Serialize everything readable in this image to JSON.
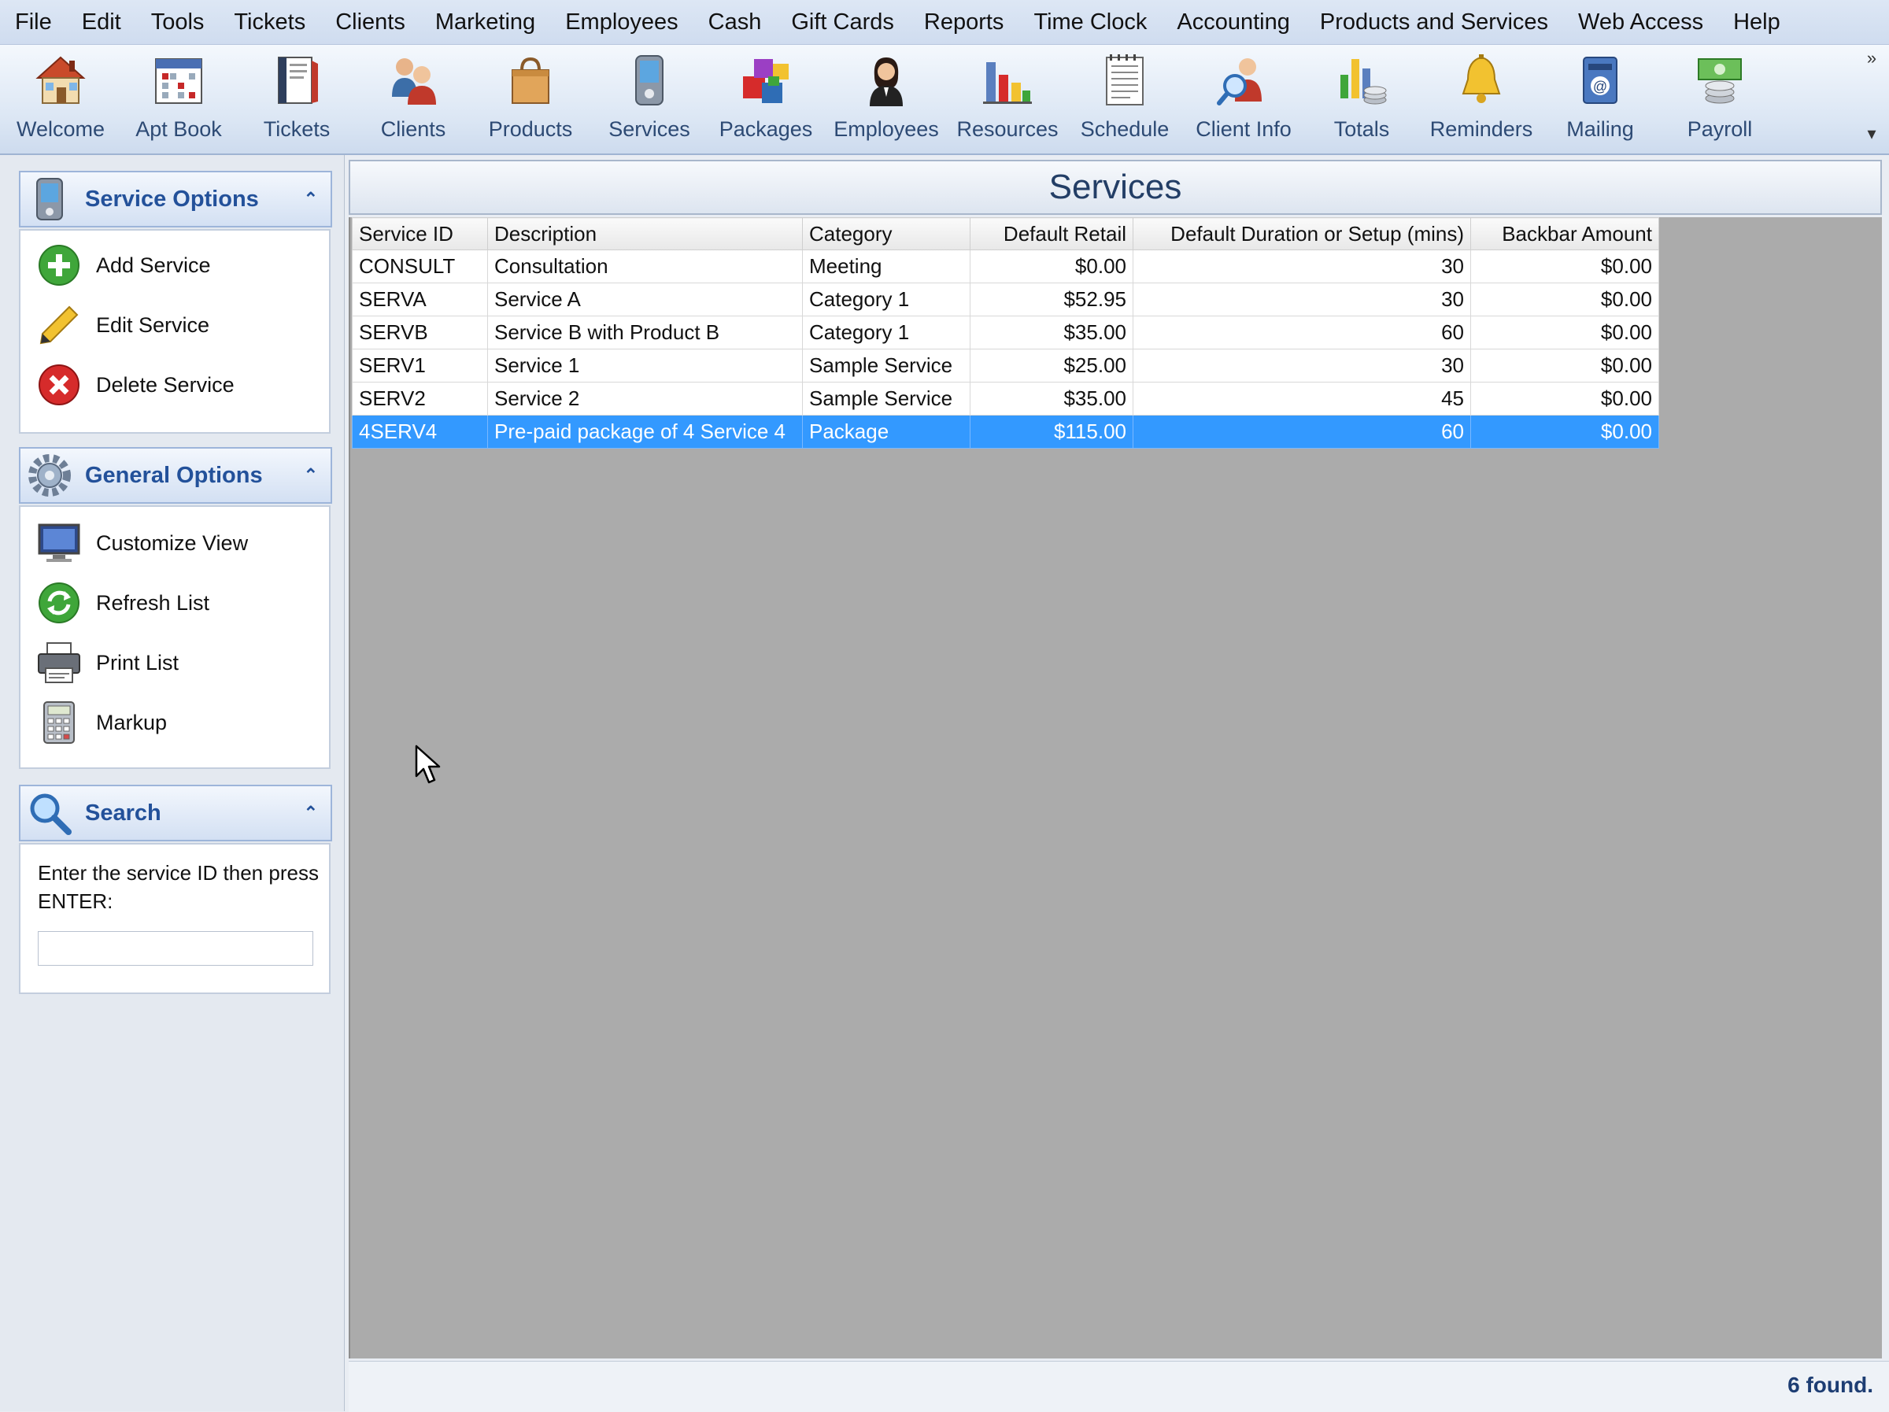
{
  "menu": [
    "File",
    "Edit",
    "Tools",
    "Tickets",
    "Clients",
    "Marketing",
    "Employees",
    "Cash",
    "Gift Cards",
    "Reports",
    "Time Clock",
    "Accounting",
    "Products and Services",
    "Web Access",
    "Help"
  ],
  "toolbar": [
    {
      "label": "Welcome",
      "icon": "house-icon"
    },
    {
      "label": "Apt Book",
      "icon": "calendar-icon"
    },
    {
      "label": "Tickets",
      "icon": "ticket-book-icon"
    },
    {
      "label": "Clients",
      "icon": "people-icon"
    },
    {
      "label": "Products",
      "icon": "shopping-bag-icon"
    },
    {
      "label": "Services",
      "icon": "pda-icon"
    },
    {
      "label": "Packages",
      "icon": "package-blocks-icon"
    },
    {
      "label": "Employees",
      "icon": "woman-icon"
    },
    {
      "label": "Resources",
      "icon": "bar-chart-icon"
    },
    {
      "label": "Schedule",
      "icon": "notepad-icon"
    },
    {
      "label": "Client Info",
      "icon": "client-search-icon"
    },
    {
      "label": "Totals",
      "icon": "coins-chart-icon"
    },
    {
      "label": "Reminders",
      "icon": "bell-icon"
    },
    {
      "label": "Mailing",
      "icon": "mailbox-icon"
    },
    {
      "label": "Payroll",
      "icon": "money-icon"
    }
  ],
  "service_options": {
    "title": "Service Options",
    "items": [
      {
        "label": "Add Service",
        "icon": "add-icon"
      },
      {
        "label": "Edit Service",
        "icon": "pencil-icon"
      },
      {
        "label": "Delete Service",
        "icon": "delete-icon"
      }
    ]
  },
  "general_options": {
    "title": "General Options",
    "items": [
      {
        "label": "Customize View",
        "icon": "monitor-icon"
      },
      {
        "label": "Refresh List",
        "icon": "refresh-icon"
      },
      {
        "label": "Print List",
        "icon": "printer-icon"
      },
      {
        "label": "Markup",
        "icon": "calculator-icon"
      }
    ]
  },
  "search": {
    "title": "Search",
    "hint": "Enter the service ID then press ENTER:",
    "value": "",
    "placeholder": ""
  },
  "main": {
    "title": "Services",
    "columns": [
      "Service ID",
      "Description",
      "Category",
      "Default Retail",
      "Default Duration or Setup (mins)",
      "Backbar Amount"
    ],
    "rows": [
      [
        "CONSULT",
        "Consultation",
        "Meeting",
        "$0.00",
        "30",
        "$0.00"
      ],
      [
        "SERVA",
        "Service A",
        "Category 1",
        "$52.95",
        "30",
        "$0.00"
      ],
      [
        "SERVB",
        "Service B with Product B",
        "Category 1",
        "$35.00",
        "60",
        "$0.00"
      ],
      [
        "SERV1",
        "Service 1",
        "Sample Service",
        "$25.00",
        "30",
        "$0.00"
      ],
      [
        "SERV2",
        "Service 2",
        "Sample Service",
        "$35.00",
        "45",
        "$0.00"
      ],
      [
        "4SERV4",
        "Pre-paid package of 4 Service 4",
        "Package",
        "$115.00",
        "60",
        "$0.00"
      ]
    ],
    "selected_row": 5
  },
  "status": {
    "found_text": "6 found."
  },
  "colors": {
    "selection": "#3399ff",
    "panel_title": "#23519a",
    "grid_background": "#ababab"
  }
}
